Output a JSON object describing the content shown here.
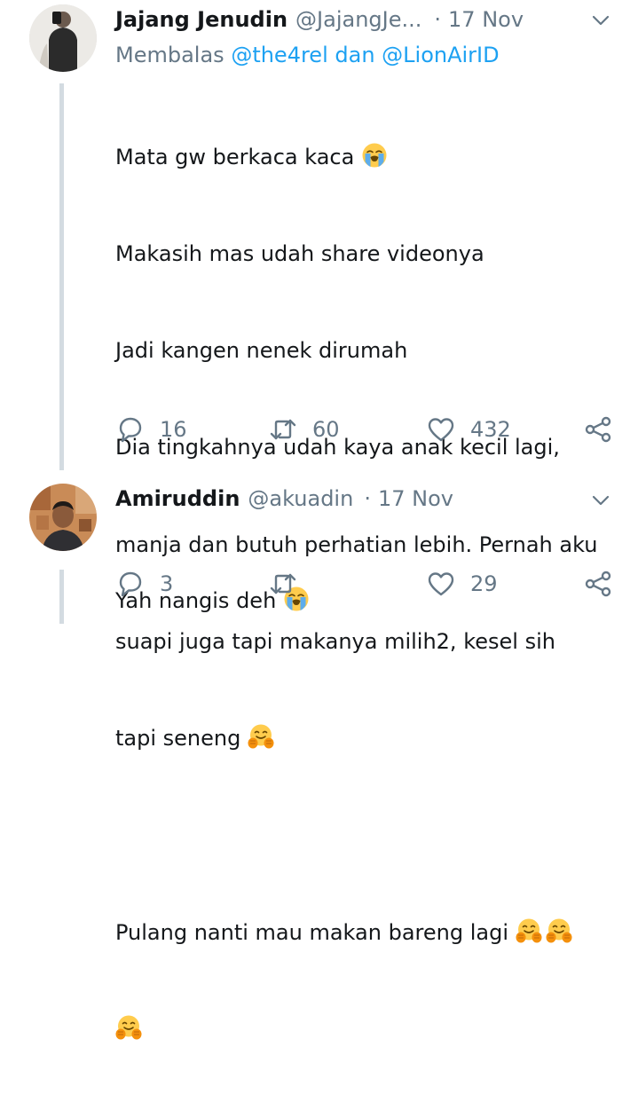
{
  "tweets": [
    {
      "name": "Jajang Jenudin",
      "handle": "@JajangJe...",
      "separator": "·",
      "date": "17 Nov",
      "reply_prefix": "Membalas",
      "reply_users": "@the4rel dan @LionAirID",
      "lines": [
        "Mata gw berkaca kaca",
        "Makasih mas udah share videonya",
        "Jadi kangen nenek dirumah",
        "Dia tingkahnya udah kaya anak kecil lagi,",
        "manja dan butuh perhatian lebih. Pernah aku",
        "suapi juga tapi makanya milih2, kesel sih",
        "tapi seneng",
        "Pulang nanti mau makan bareng lagi"
      ],
      "emoji": [
        "crying-face",
        "hugging-face"
      ],
      "reply_count": "16",
      "retweet_count": "60",
      "like_count": "432"
    },
    {
      "name": "Amiruddin",
      "handle": "@akuadin",
      "separator": "·",
      "date": "17 Nov",
      "lines": [
        "Yah nangis deh"
      ],
      "emoji": [
        "crying-face"
      ],
      "reply_count": "3",
      "retweet_count": "",
      "like_count": "29"
    }
  ],
  "colors": {
    "text": "#14171a",
    "secondary": "#657786",
    "link": "#1da1f2",
    "thread_line": "#d3dbe1",
    "emoji_yellow": "#ffcc4d"
  },
  "icons": [
    "reply-icon",
    "retweet-icon",
    "like-icon",
    "share-icon",
    "chevron-down-icon"
  ]
}
